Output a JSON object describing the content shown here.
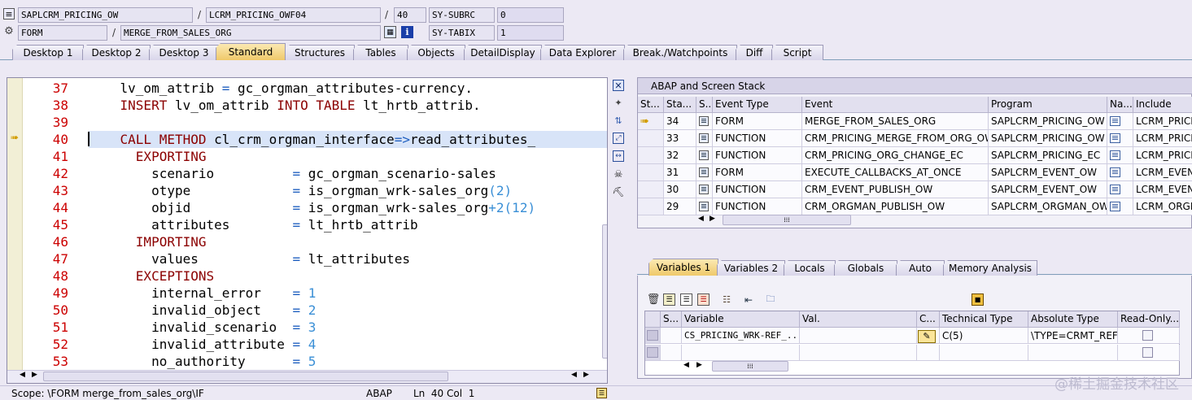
{
  "header": {
    "row1": {
      "program": "SAPLCRM_PRICING_OW",
      "include": "LCRM_PRICING_OWF04",
      "line": "40",
      "sysvar": "SY-SUBRC",
      "sysval": "0"
    },
    "row2": {
      "type": "FORM",
      "name": "MERGE_FROM_SALES_ORG",
      "sysvar": "SY-TABIX",
      "sysval": "1"
    },
    "sep": "/"
  },
  "tabs": [
    {
      "label": "Desktop 1"
    },
    {
      "label": "Desktop 2"
    },
    {
      "label": "Desktop 3"
    },
    {
      "label": "Standard",
      "active": true
    },
    {
      "label": "Structures"
    },
    {
      "label": "Tables"
    },
    {
      "label": "Objects"
    },
    {
      "label": "DetailDisplay"
    },
    {
      "label": "Data Explorer"
    },
    {
      "label": "Break./Watchpoints"
    },
    {
      "label": "Diff"
    },
    {
      "label": "Script"
    }
  ],
  "code": {
    "current_line": "40",
    "lines": [
      {
        "n": "37",
        "text": "    lv_om_attrib = gc_orgman_attributes-currency."
      },
      {
        "n": "38",
        "text": "    INSERT lv_om_attrib INTO TABLE lt_hrtb_attrib."
      },
      {
        "n": "39",
        "text": ""
      },
      {
        "n": "40",
        "text": "    CALL METHOD cl_crm_orgman_interface=>read_attributes_"
      },
      {
        "n": "41",
        "text": "      EXPORTING"
      },
      {
        "n": "42",
        "text": "        scenario          = gc_orgman_scenario-sales"
      },
      {
        "n": "43",
        "text": "        otype             = is_orgman_wrk-sales_org(2)"
      },
      {
        "n": "44",
        "text": "        objid             = is_orgman_wrk-sales_org+2(12)"
      },
      {
        "n": "45",
        "text": "        attributes        = lt_hrtb_attrib"
      },
      {
        "n": "46",
        "text": "      IMPORTING"
      },
      {
        "n": "47",
        "text": "        values            = lt_attributes"
      },
      {
        "n": "48",
        "text": "      EXCEPTIONS"
      },
      {
        "n": "49",
        "text": "        internal_error    = 1"
      },
      {
        "n": "50",
        "text": "        invalid_object    = 2"
      },
      {
        "n": "51",
        "text": "        invalid_scenario  = 3"
      },
      {
        "n": "52",
        "text": "        invalid_attribute = 4"
      },
      {
        "n": "53",
        "text": "        no_authority      = 5"
      }
    ]
  },
  "stack": {
    "title": "ABAP and Screen Stack",
    "columns": [
      "St...",
      "Sta...",
      "S...",
      "Event Type",
      "Event",
      "Program",
      "Na...",
      "Include"
    ],
    "rows": [
      {
        "current": true,
        "level": "34",
        "event_type": "FORM",
        "event": "MERGE_FROM_SALES_ORG",
        "program": "SAPLCRM_PRICING_OW",
        "include": "LCRM_PRICIN"
      },
      {
        "current": false,
        "level": "33",
        "event_type": "FUNCTION",
        "event": "CRM_PRICING_MERGE_FROM_ORG_OW",
        "program": "SAPLCRM_PRICING_OW",
        "include": "LCRM_PRICIN"
      },
      {
        "current": false,
        "level": "32",
        "event_type": "FUNCTION",
        "event": "CRM_PRICING_ORG_CHANGE_EC",
        "program": "SAPLCRM_PRICING_EC",
        "include": "LCRM_PRICIN"
      },
      {
        "current": false,
        "level": "31",
        "event_type": "FORM",
        "event": "EXECUTE_CALLBACKS_AT_ONCE",
        "program": "SAPLCRM_EVENT_OW",
        "include": "LCRM_EVENT"
      },
      {
        "current": false,
        "level": "30",
        "event_type": "FUNCTION",
        "event": "CRM_EVENT_PUBLISH_OW",
        "program": "SAPLCRM_EVENT_OW",
        "include": "LCRM_EVENT"
      },
      {
        "current": false,
        "level": "29",
        "event_type": "FUNCTION",
        "event": "CRM_ORGMAN_PUBLISH_OW",
        "program": "SAPLCRM_ORGMAN_OW",
        "include": "LCRM_ORGMA"
      }
    ]
  },
  "var_tabs": [
    {
      "label": "Variables 1",
      "active": true
    },
    {
      "label": "Variables 2"
    },
    {
      "label": "Locals"
    },
    {
      "label": "Globals"
    },
    {
      "label": "Auto"
    },
    {
      "label": "Memory Analysis"
    }
  ],
  "variables": {
    "columns": [
      "S...",
      "Variable",
      "Val.",
      "C...",
      "Technical Type",
      "Absolute Type",
      "Read-Only..."
    ],
    "rows": [
      {
        "variable": "CS_PRICING_WRK-REF_...",
        "value": "",
        "technical_type": "C(5)",
        "absolute_type": "\\TYPE=CRMT_REF..."
      }
    ]
  },
  "statusbar": {
    "scope": "Scope: \\FORM merge_from_sales_org\\IF",
    "lang": "ABAP",
    "pos": "Ln  40 Col  1"
  },
  "watermark": "@稀土掘金技术社区",
  "colors": {
    "linenum": "#cc0000",
    "keyword": "#8b0000",
    "number": "#3a8fd6",
    "active_tab": "#efc96a"
  }
}
